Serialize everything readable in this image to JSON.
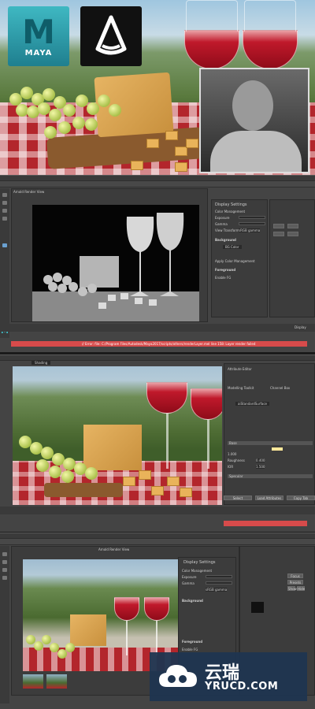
{
  "logos": {
    "maya": "MAYA"
  },
  "panel1": {
    "title": "Arnold Render View",
    "settings_header": "Display Settings",
    "color_management": "Color Management",
    "exposure_label": "Exposure",
    "gamma_label": "Gamma",
    "view_transform_label": "View Transform",
    "view_transform_value": "sRGB gamma",
    "background_label": "Background",
    "bg_value": "BG Color",
    "apply_cm": "Apply Color Management",
    "foreground_label": "Foreground",
    "enable_fg": "Enable FG",
    "frame_label": "Display",
    "red_bar_text": "// Error: file: C:/Program Files/Autodesk/Maya2017/scripts/others/renderLayer.mel line 158: Layer render failed"
  },
  "panel2": {
    "title": "Shading",
    "tabs": [
      "Attribute Editor",
      "Modelling Toolkit",
      "Channel Box"
    ],
    "node_label": "aiStandardSurface",
    "section_base": "Base",
    "section_specular": "Specular",
    "roughness_label": "Roughness",
    "roughness_value": "0.400",
    "ior_label": "IOR",
    "ior_value": "1.500",
    "weight_value": "1.000",
    "bottom_buttons": [
      "Select",
      "Load Attributes",
      "Copy Tab"
    ]
  },
  "panel3": {
    "title": "Arnold Render View",
    "settings_header": "Display Settings",
    "color_management": "Color Management",
    "exposure_label": "Exposure",
    "gamma_label": "Gamma",
    "view_transform_value": "sRGB gamma",
    "background_label": "Background",
    "foreground_label": "Foreground",
    "enable_fg": "Enable FG",
    "focus": "Focus",
    "presets": "Presets",
    "show": "Show",
    "hide": "Hide"
  },
  "watermark": {
    "title": "云瑞",
    "url": "YRUCD.COM"
  },
  "colors": {
    "maya_teal": "#3fb8c2",
    "wine": "#b3162a",
    "watermark_bg": "#1f3550",
    "error_red": "#d74b4b"
  }
}
